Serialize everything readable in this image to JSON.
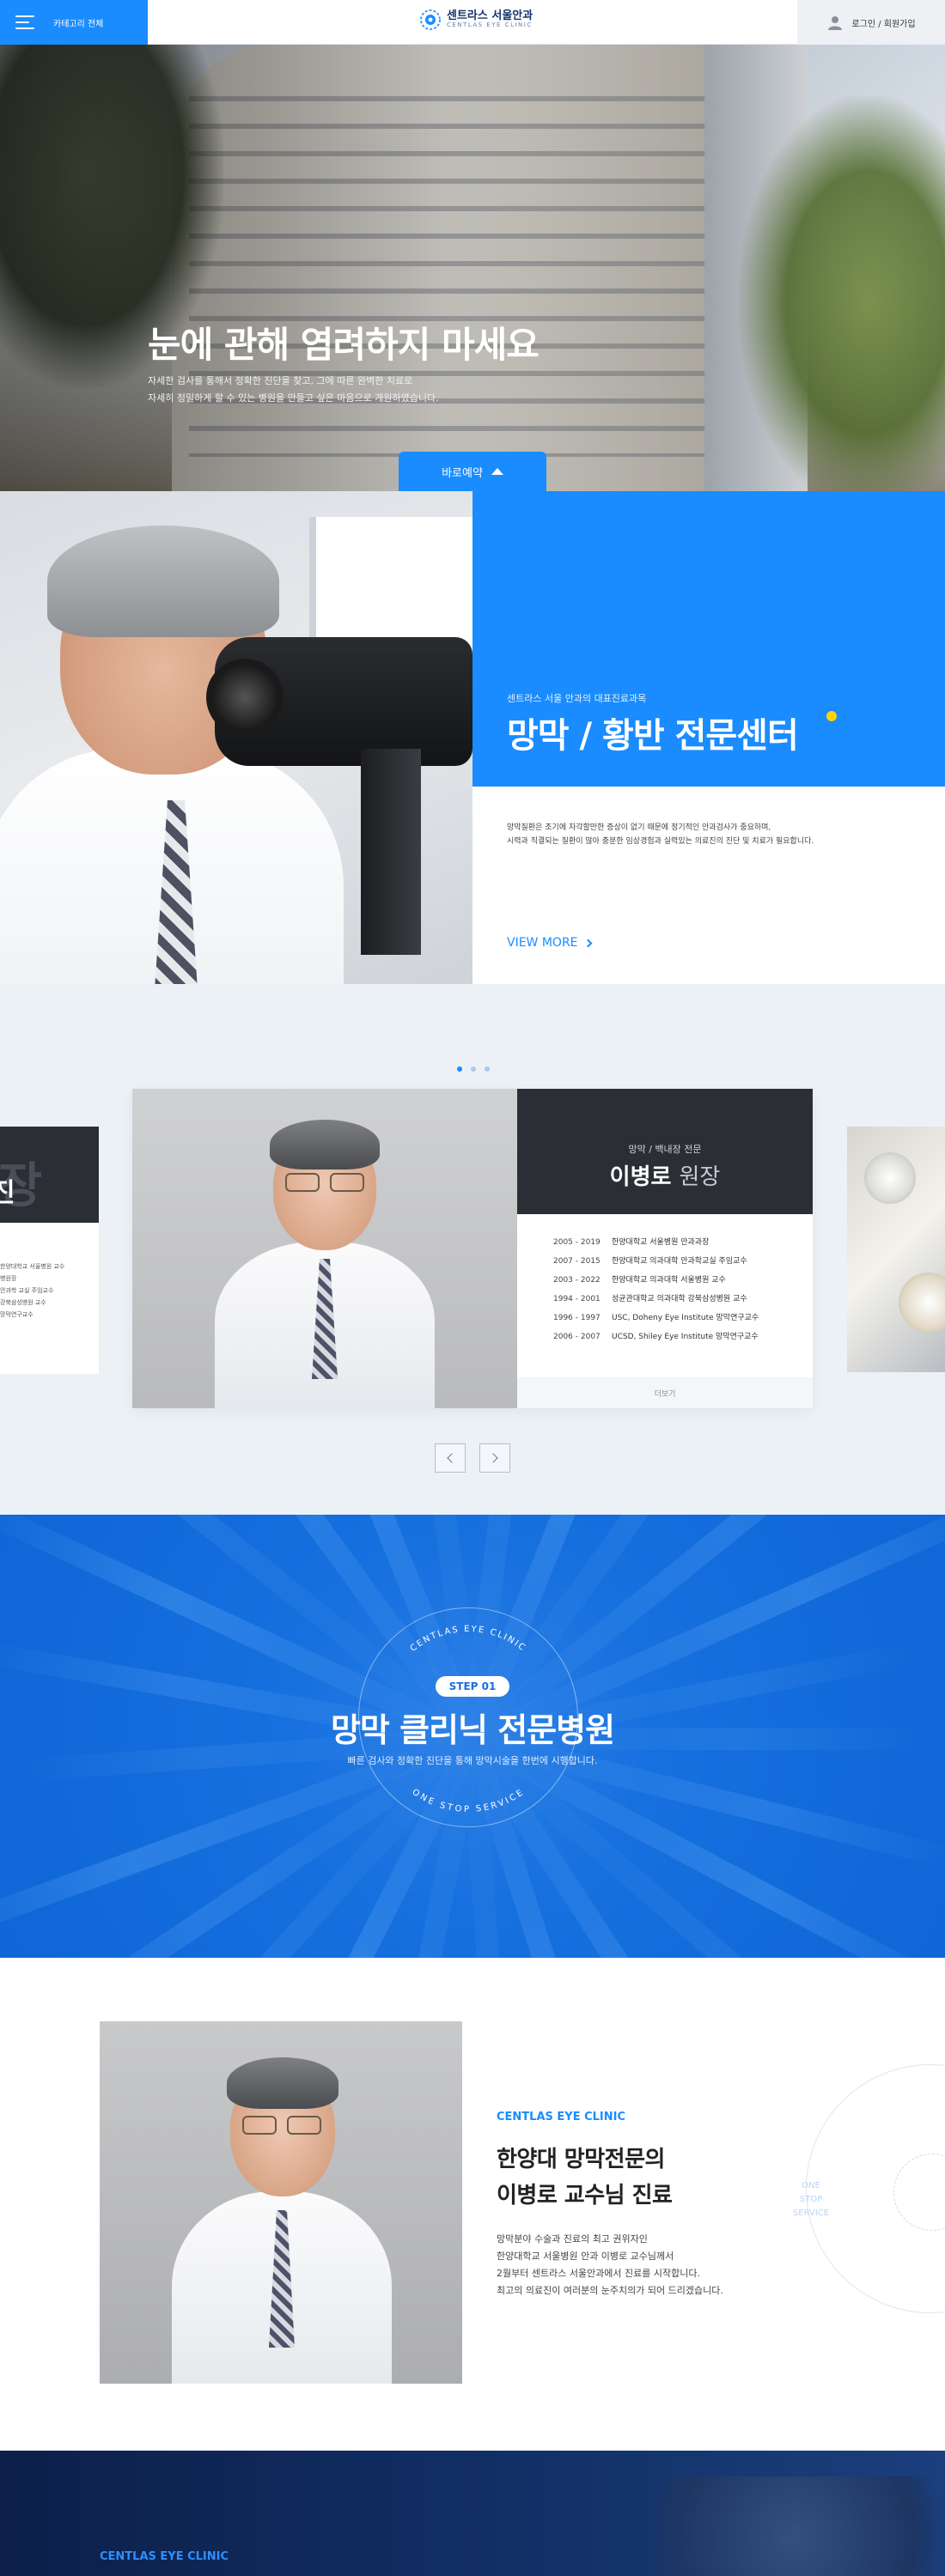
{
  "header": {
    "menu_label": "카테고리 전체",
    "logo_kr": "센트라스 서울안과",
    "logo_en": "CENTLAS EYE CLINIC",
    "login_label": "로그인 / 회원가입"
  },
  "hero": {
    "title": "눈에 관해 염려하지 마세요",
    "desc_line1": "자세한 검사를 통해서 정확한 진단을 찾고, 그에 따른 완벽한 치료로",
    "desc_line2": "자세히 정밀하게 할 수 있는 병원을 만들고 싶은 마음으로 개원하였습니다.",
    "book_label": "바로예약"
  },
  "center": {
    "subtitle": "센트라스 서울 안과의 대표진료과목",
    "title": "망막 / 황반 전문센터",
    "desc_line1": "망막질환은 조기에 자각할만한 증상이 없기 때문에 정기적인 안과검사가 중요하며,",
    "desc_line2": "시력과 직결되는 질환이 많아 충분한 임상경험과 실력있는 의료진의 진단 및 치료가 필요합니다.",
    "view_more": "VIEW MORE"
  },
  "doctor_card": {
    "subtitle": "망막 / 백내장 전문",
    "name": "이병로",
    "rank": "원장",
    "career": [
      {
        "year": "2005 - 2019",
        "text": "한양대학교 서울병원 안과과장"
      },
      {
        "year": "2007 - 2015",
        "text": "한양대학교 의과대학 안과학교실 주임교수"
      },
      {
        "year": "2003 - 2022",
        "text": "한양대학교 의과대학 서울병원 교수"
      },
      {
        "year": "1994 - 2001",
        "text": "성균관대학교 의과대학 강북삼성병원 교수"
      },
      {
        "year": "1996 - 1997",
        "text": "USC, Doheny Eye Institute 망막연구교수"
      },
      {
        "year": "2006 - 2007",
        "text": "UCSD, Shiley Eye Institute 망막연구교수"
      }
    ],
    "more_label": "더보기"
  },
  "left_card": {
    "big_text": "원장",
    "big_text2": "진",
    "rows": [
      "한양대학교 서울병원 교수",
      "병원장",
      "안과학 교실 주임교수",
      "강북삼성병원 교수",
      "망막연구교수"
    ]
  },
  "step": {
    "badge": "STEP 01",
    "title": "망막 클리닉 전문병원",
    "desc": "빠른 검사와 정확한 진단을 통해 망막시술을 한번에 시행합니다.",
    "ring_top": "CENTLAS EYE CLINIC",
    "ring_bottom": "ONE STOP SERVICE"
  },
  "professor": {
    "eyebrow": "CENTLAS EYE CLINIC",
    "title_line1": "한양대 망막전문의",
    "title_line2": "이병로 교수님 진료",
    "desc_line1": "망막분야 수술과 진료의 최고 권위자인",
    "desc_line2": "한양대학교 서울병원 안과 이병로 교수님께서",
    "desc_line3": "2월부터 센트라스 서울안과에서 진료를 시작합니다.",
    "desc_line4": "최고의 의료진이 여러분의 눈주치의가 되어 드리겠습니다.",
    "deco_line1": "ONE",
    "deco_line2": "STOP",
    "deco_line3": "SERVICE"
  },
  "dark_section": {
    "eyebrow": "CENTLAS EYE CLINIC"
  },
  "colors": {
    "accent": "#1a8cff",
    "dark_card": "#2b2e35",
    "highlight": "#ffd400",
    "section_bg": "#ecf1f6"
  }
}
